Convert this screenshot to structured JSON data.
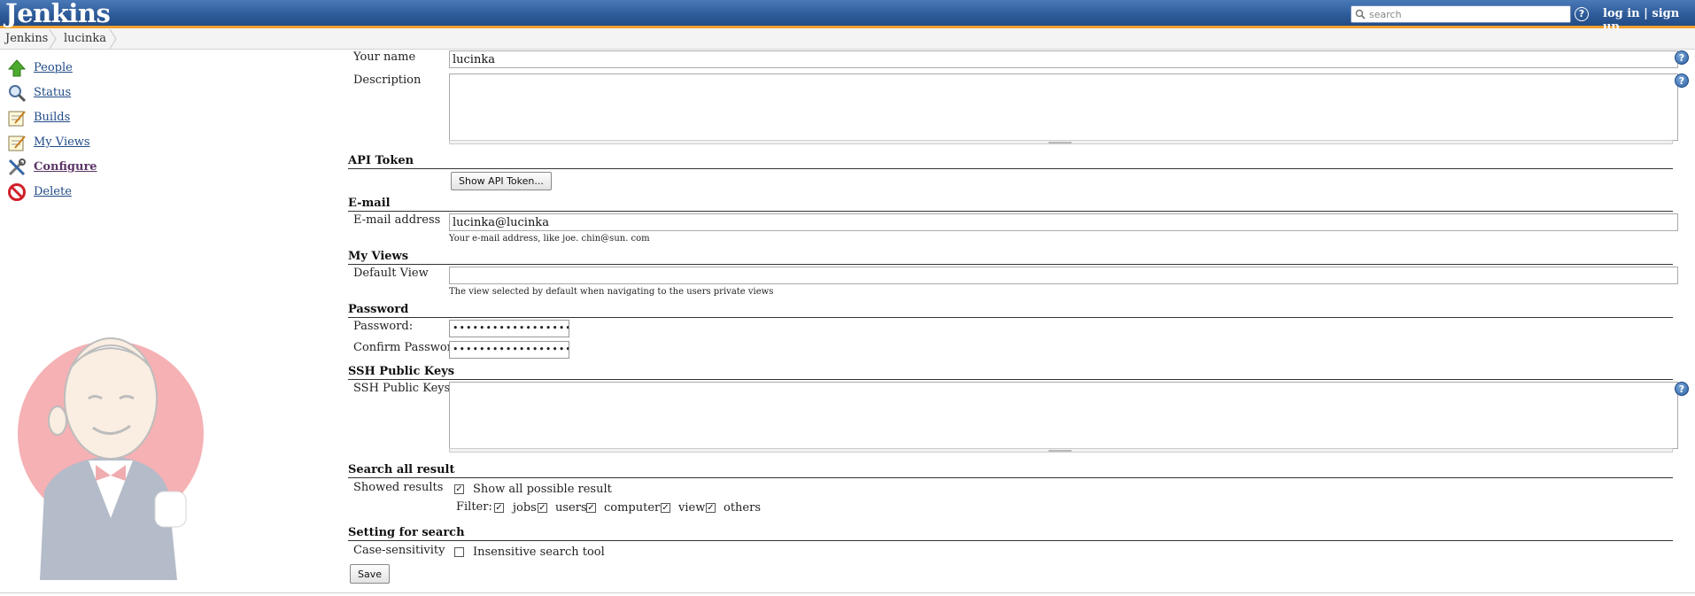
{
  "header": {
    "logo": "Jenkins",
    "search_placeholder": "search",
    "help": "?",
    "login": "log in",
    "separator": "|",
    "signup": "sign up"
  },
  "breadcrumb": [
    "Jenkins",
    "lucinka"
  ],
  "sidebar": {
    "items": [
      {
        "label": "People",
        "icon": "up-arrow-icon"
      },
      {
        "label": "Status",
        "icon": "magnifier-icon"
      },
      {
        "label": "Builds",
        "icon": "notepad-icon"
      },
      {
        "label": "My Views",
        "icon": "notepad-icon"
      },
      {
        "label": "Configure",
        "icon": "tools-icon"
      },
      {
        "label": "Delete",
        "icon": "no-entry-icon"
      }
    ]
  },
  "form": {
    "your_name_label": "Your name",
    "your_name_value": "lucinka",
    "description_label": "Description",
    "api_token_header": "API Token",
    "show_api_token": "Show API Token...",
    "email_header": "E-mail",
    "email_label": "E-mail address",
    "email_value": "lucinka@lucinka",
    "email_hint": "Your e-mail address, like joe. chin@sun. com",
    "myviews_header": "My Views",
    "default_view_label": "Default View",
    "default_view_value": "",
    "default_view_hint": "The view selected by default when navigating to the users private views",
    "password_header": "Password",
    "password_label": "Password:",
    "password_mask": "••••••••••••••••••••••",
    "confirm_label": "Confirm Password:",
    "confirm_mask": "••••••••••••••••••••••",
    "ssh_header": "SSH Public Keys",
    "ssh_label": "SSH Public Keys",
    "search_header": "Search all result",
    "showed_results_label": "Showed results",
    "show_all_label": "Show all possible result",
    "filter_label": "Filter:",
    "filters": [
      {
        "label": "jobs",
        "checked": true
      },
      {
        "label": "users",
        "checked": true
      },
      {
        "label": "computers",
        "checked": true
      },
      {
        "label": "view",
        "checked": true
      },
      {
        "label": "others",
        "checked": true
      }
    ],
    "setting_header": "Setting for search",
    "case_label": "Case-sensitivity",
    "insensitive_label": "Insensitive search tool",
    "insensitive_checked": false,
    "show_all_checked": true,
    "save": "Save"
  },
  "colors": {
    "header_blue": "#2d5a98",
    "header_stripe": "#f0a030",
    "link": "#204a87"
  }
}
